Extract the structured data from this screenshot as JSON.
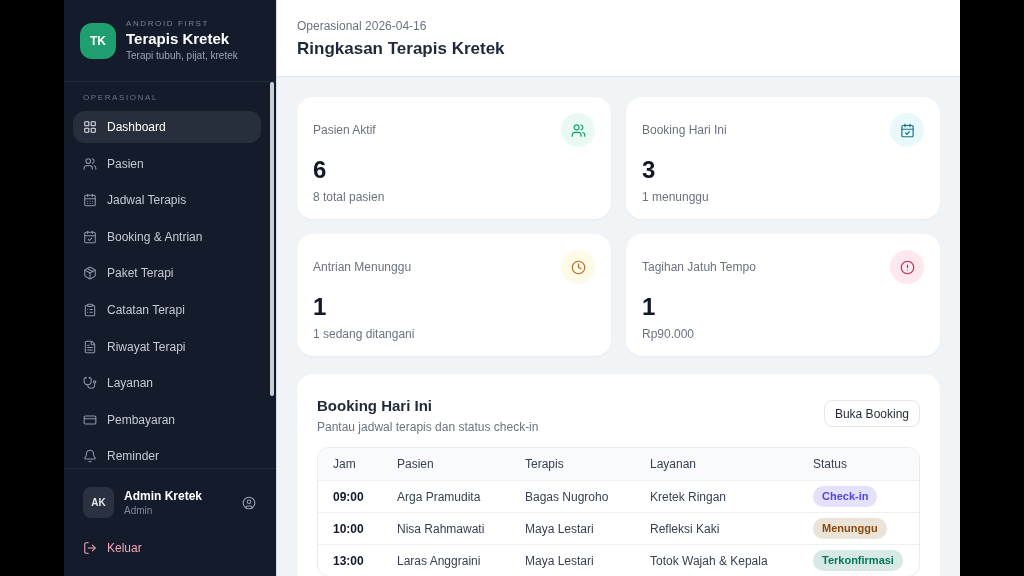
{
  "sidebar": {
    "brand": {
      "logo": "TK",
      "eyebrow": "ANDROID FIRST",
      "title": "Terapis Kretek",
      "subtitle": "Terapi tubuh, pijat, kretek"
    },
    "section_label": "OPERASIONAL",
    "items": [
      {
        "label": "Dashboard",
        "selected": true
      },
      {
        "label": "Pasien",
        "selected": false
      },
      {
        "label": "Jadwal Terapis",
        "selected": false
      },
      {
        "label": "Booking & Antrian",
        "selected": false
      },
      {
        "label": "Paket Terapi",
        "selected": false
      },
      {
        "label": "Catatan Terapi",
        "selected": false
      },
      {
        "label": "Riwayat Terapi",
        "selected": false
      },
      {
        "label": "Layanan",
        "selected": false
      },
      {
        "label": "Pembayaran",
        "selected": false
      },
      {
        "label": "Reminder",
        "selected": false
      }
    ],
    "user": {
      "initials": "AK",
      "name": "Admin Kretek",
      "role": "Admin"
    },
    "logout": "Keluar"
  },
  "header": {
    "eyebrow": "Operasional 2026-04-16",
    "title": "Ringkasan Terapis Kretek"
  },
  "stats": [
    {
      "label": "Pasien Aktif",
      "value": "6",
      "note": "8 total pasien"
    },
    {
      "label": "Booking Hari Ini",
      "value": "3",
      "note": "1 menunggu"
    },
    {
      "label": "Antrian Menunggu",
      "value": "1",
      "note": "1 sedang ditangani"
    },
    {
      "label": "Tagihan Jatuh Tempo",
      "value": "1",
      "note": "Rp90.000"
    }
  ],
  "bookings": {
    "title": "Booking Hari Ini",
    "subtitle": "Pantau jadwal terapis dan status check-in",
    "button": "Buka Booking",
    "columns": [
      "Jam",
      "Pasien",
      "Terapis",
      "Layanan",
      "Status"
    ],
    "rows": [
      {
        "time": "09:00",
        "patient": "Arga Pramudita",
        "therapist": "Bagas Nugroho",
        "service": "Kretek Ringan",
        "status": {
          "label": "Check-in",
          "color": "#4f46e5"
        }
      },
      {
        "time": "10:00",
        "patient": "Nisa Rahmawati",
        "therapist": "Maya Lestari",
        "service": "Refleksi Kaki",
        "status": {
          "label": "Menunggu",
          "color": "#854d0e"
        }
      },
      {
        "time": "13:00",
        "patient": "Laras Anggraini",
        "therapist": "Maya Lestari",
        "service": "Totok Wajah & Kepala",
        "status": {
          "label": "Terkonfirmasi",
          "color": "#047857"
        }
      }
    ]
  }
}
